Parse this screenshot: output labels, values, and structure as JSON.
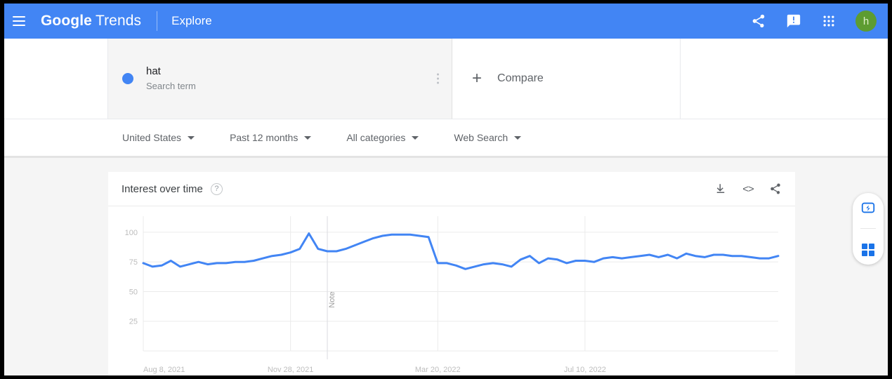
{
  "appbar": {
    "menu_icon": "hamburger-menu-icon",
    "brand_google": "Google",
    "brand_trends": "Trends",
    "explore": "Explore",
    "share_icon": "share-icon",
    "feedback_icon": "feedback-icon",
    "apps_icon": "apps-grid-icon",
    "avatar_letter": "h",
    "bg_color": "#4285f4",
    "avatar_color": "#5d9c31"
  },
  "search": {
    "term": "hat",
    "type_label": "Search term",
    "dot_color": "#4285f4",
    "menu_icon": "more-vert-icon",
    "compare_label": "Compare",
    "compare_icon": "plus-icon"
  },
  "filters": [
    {
      "label": "United States",
      "name": "location"
    },
    {
      "label": "Past 12 months",
      "name": "time-range"
    },
    {
      "label": "All categories",
      "name": "category"
    },
    {
      "label": "Web Search",
      "name": "search-type"
    }
  ],
  "card": {
    "title": "Interest over time",
    "help_glyph": "?",
    "download_icon": "download-icon",
    "embed_icon": "embed-code-icon",
    "embed_glyph": "<>",
    "share_icon": "share-icon"
  },
  "fab": {
    "assistant_icon": "lightning-bolt-box-icon",
    "grid_icon": "four-square-grid-icon",
    "color": "#1a73e8"
  },
  "chart_data": {
    "type": "line",
    "title": "Interest over time",
    "xlabel": "",
    "ylabel": "",
    "ylim": [
      0,
      110
    ],
    "yticks": [
      100,
      75,
      50,
      25
    ],
    "grid": true,
    "legend": false,
    "line_color": "#4285f4",
    "annotation": {
      "text": "Note",
      "x_index": 20,
      "orientation": "vertical"
    },
    "xticks": [
      {
        "label": "Aug 8, 2021",
        "index": 0
      },
      {
        "label": "Nov 28, 2021",
        "index": 16
      },
      {
        "label": "Mar 20, 2022",
        "index": 32
      },
      {
        "label": "Jul 10, 2022",
        "index": 48
      }
    ],
    "series": [
      {
        "name": "hat",
        "color": "#4285f4",
        "values": [
          74,
          71,
          72,
          76,
          71,
          73,
          75,
          73,
          74,
          74,
          75,
          75,
          76,
          78,
          80,
          81,
          83,
          86,
          99,
          86,
          84,
          84,
          86,
          89,
          92,
          95,
          97,
          98,
          98,
          98,
          97,
          96,
          74,
          74,
          72,
          69,
          71,
          73,
          74,
          73,
          71,
          77,
          80,
          74,
          78,
          77,
          74,
          76,
          76,
          75,
          78,
          79,
          78,
          79,
          80,
          81,
          79,
          81,
          78,
          82,
          80,
          79,
          81,
          81,
          80,
          80,
          79,
          78,
          78,
          80
        ]
      }
    ]
  }
}
